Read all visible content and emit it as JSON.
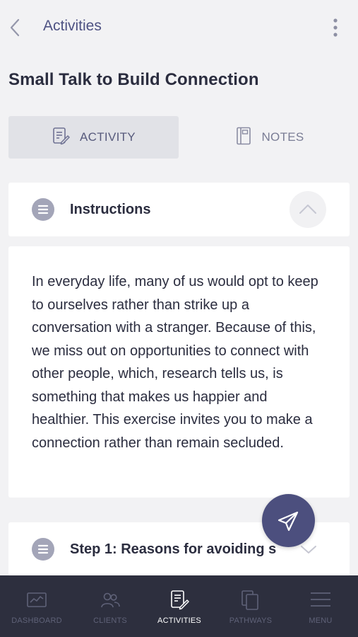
{
  "header": {
    "title": "Activities"
  },
  "page": {
    "title": "Small Talk to Build Connection"
  },
  "tabs": [
    {
      "label": "ACTIVITY",
      "active": true
    },
    {
      "label": "NOTES",
      "active": false
    }
  ],
  "instructions": {
    "title": "Instructions",
    "expanded": true,
    "text": "In everyday life, many of us would opt to keep to ourselves rather than strike up a conversation with a stranger. Because of this, we miss out on opportunities to connect with other people, which, research tells us, is something that makes us happier and healthier. This exercise invites you to make a connection rather than remain secluded."
  },
  "step1": {
    "title": "Step 1: Reasons for avoiding s"
  },
  "bottom_nav": [
    {
      "label": "DASHBOARD",
      "icon": "chart-icon",
      "active": false
    },
    {
      "label": "CLIENTS",
      "icon": "people-icon",
      "active": false
    },
    {
      "label": "ACTIVITIES",
      "icon": "activity-icon",
      "active": true
    },
    {
      "label": "PATHWAYS",
      "icon": "pages-icon",
      "active": false
    },
    {
      "label": "MENU",
      "icon": "hamburger-icon",
      "active": false
    }
  ],
  "colors": {
    "background": "#f2f2f4",
    "accent": "#4c4f7e",
    "nav_background": "#2d2f3e",
    "active_tab": "#e1e2e7"
  }
}
